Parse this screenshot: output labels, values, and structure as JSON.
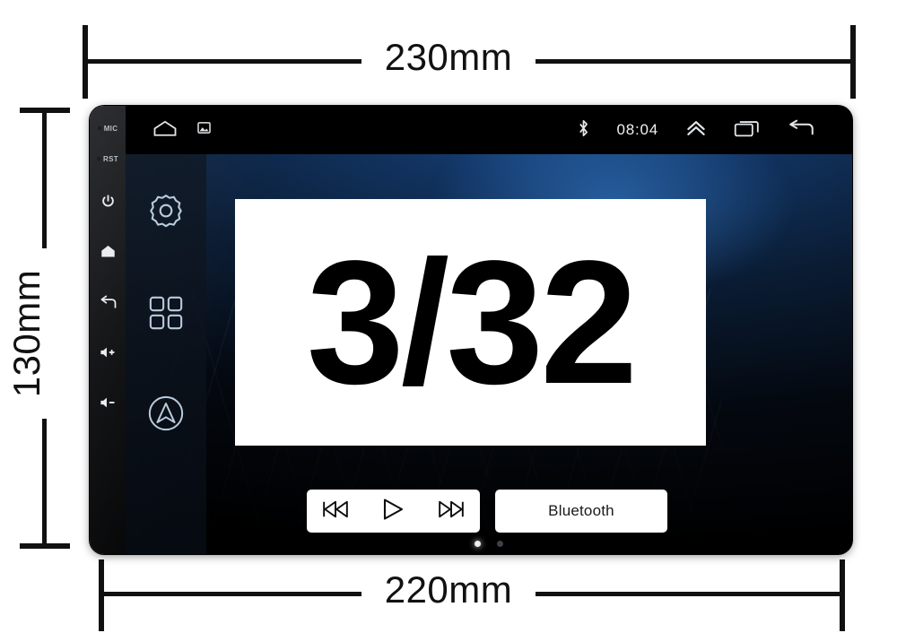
{
  "annotations": {
    "width_top": "230mm",
    "width_bottom": "220mm",
    "height_left": "130mm"
  },
  "device": {
    "bezel_buttons": [
      {
        "name": "mic",
        "label": "MIC",
        "icon": "microphone-hole"
      },
      {
        "name": "reset",
        "label": "RST",
        "icon": "reset-hole"
      },
      {
        "name": "power",
        "label": "",
        "icon": "power-icon"
      },
      {
        "name": "home",
        "label": "",
        "icon": "home-icon"
      },
      {
        "name": "back",
        "label": "",
        "icon": "back-arrow-icon"
      },
      {
        "name": "volume-up",
        "label": "",
        "icon": "volume-up-icon"
      },
      {
        "name": "volume-down",
        "label": "",
        "icon": "volume-down-icon"
      }
    ],
    "status_bar": {
      "home_icon": "home-icon",
      "screenshot_icon": "screenshot-icon",
      "bluetooth_icon": "bluetooth-icon",
      "clock": "08:04",
      "expand_icon": "chevron-up-icon",
      "recents_icon": "recents-icon",
      "back_icon": "back-arrow-icon"
    },
    "nav_rail": [
      {
        "name": "settings",
        "icon": "gear-icon"
      },
      {
        "name": "apps",
        "icon": "grid-apps-icon"
      },
      {
        "name": "navigation",
        "icon": "navigation-arrow-icon"
      }
    ],
    "media_controls": [
      {
        "name": "previous",
        "icon": "previous-track-icon"
      },
      {
        "name": "play",
        "icon": "play-icon"
      },
      {
        "name": "next",
        "icon": "next-track-icon"
      }
    ],
    "bluetooth_widget": {
      "label": "Bluetooth",
      "icon": "bluetooth-phone-icon",
      "color": "#2f86cf"
    },
    "page_indicator": {
      "total": 2,
      "active": 1
    }
  },
  "overlay": {
    "spec_text": "3/32"
  },
  "colors": {
    "accent_blue": "#2f86cf",
    "wallpaper_blue": "#1b4f8f",
    "bezel_black": "#0a0b0d",
    "text_dark": "#111111"
  }
}
